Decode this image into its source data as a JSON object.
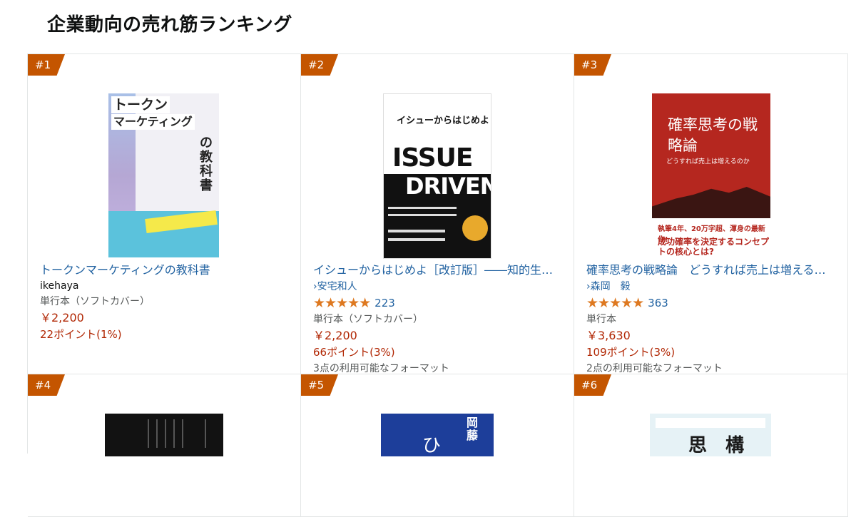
{
  "page": {
    "title": "企業動向の売れ筋ランキング"
  },
  "colors": {
    "badge": "#c45500",
    "link": "#2162a1",
    "price": "#b12704",
    "stars": "#de7921"
  },
  "products": [
    {
      "rank": "#1",
      "title": "トークンマーケティングの教科書",
      "author": "ikehaya",
      "format": "単行本（ソフトカバー）",
      "price": "￥2,200",
      "points": "22ポイント(1%)",
      "cover": {
        "line1": "トークン",
        "line2": "マーケティング",
        "line3": "の教科書"
      }
    },
    {
      "rank": "#2",
      "title": "イシューからはじめよ［改訂版］――知的生…",
      "author": "›安宅和人",
      "rating_stars": "★★★★★",
      "rating_value": 4.5,
      "rating_count": "223",
      "format": "単行本（ソフトカバー）",
      "price": "￥2,200",
      "points": "66ポイント(3%)",
      "formats_note": "3点の利用可能なフォーマット",
      "cover": {
        "heading": "イシューからはじめよ",
        "big1": "ISSUE",
        "big2": "DRIVEN+"
      }
    },
    {
      "rank": "#3",
      "title": "確率思考の戦略論　どうすれば売上は増える…",
      "author": "›森岡　毅",
      "rating_stars": "★★★★★",
      "rating_value": 4.5,
      "rating_count": "363",
      "format": "単行本",
      "price": "￥3,630",
      "points": "109ポイント(3%)",
      "formats_note": "2点の利用可能なフォーマット",
      "cover": {
        "title": "確率思考の戦略論",
        "subtitle": "どうすれば売上は増えるのか",
        "band1": "執筆4年、20万字超、渾身の最新作!",
        "band2": "成功確率を決定するコンセプトの核心とは?"
      }
    },
    {
      "rank": "#4"
    },
    {
      "rank": "#5",
      "cover": {
        "a": "岡藤",
        "b": "ひ"
      }
    },
    {
      "rank": "#6",
      "cover": {
        "a": "思　構"
      }
    }
  ]
}
